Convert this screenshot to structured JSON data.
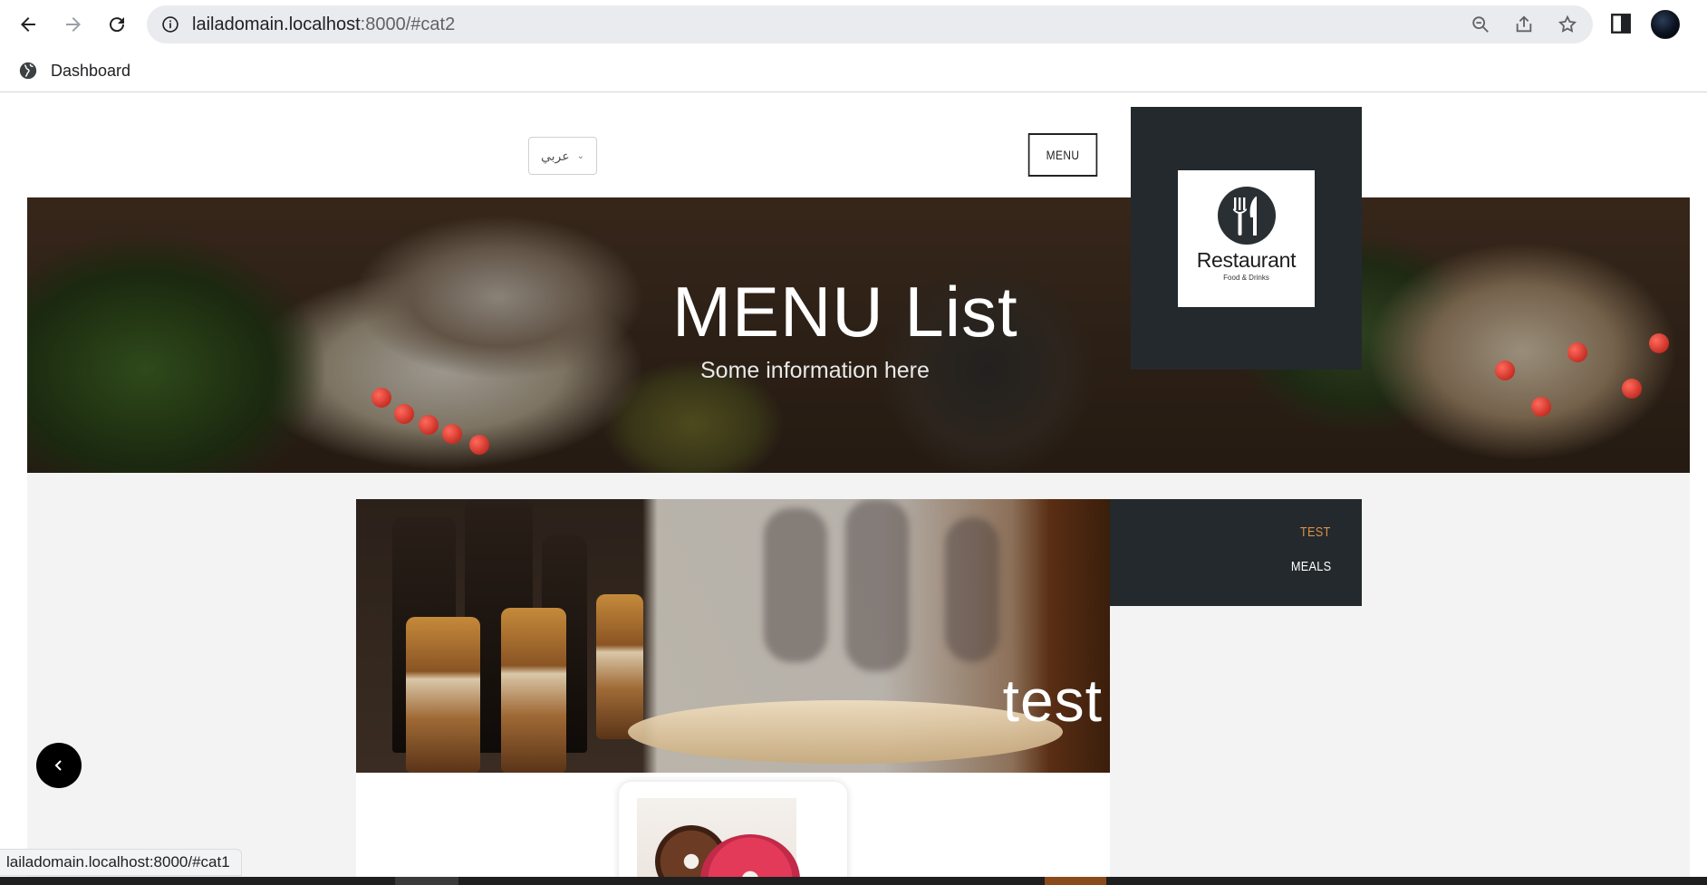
{
  "browser": {
    "url_host": "lailadomain.localhost",
    "url_rest": ":8000/#cat2",
    "bookmarks": [
      {
        "label": "Dashboard",
        "icon": "globe-icon"
      }
    ],
    "status_url": "lailadomain.localhost:8000/#cat1"
  },
  "header": {
    "language_selected": "عربي",
    "menu_button": "MENU",
    "logo": {
      "name": "Restaurant",
      "tagline": "Food & Drinks"
    }
  },
  "hero": {
    "title": "MENU List",
    "subtitle": "Some information here"
  },
  "categories": [
    {
      "label": "TEST",
      "active": true
    },
    {
      "label": "MEALS",
      "active": false
    }
  ],
  "feature": {
    "title": "test"
  },
  "colors": {
    "accent": "#d9914b",
    "dark_panel": "#24292d",
    "content_bg": "#f2f3f2"
  }
}
